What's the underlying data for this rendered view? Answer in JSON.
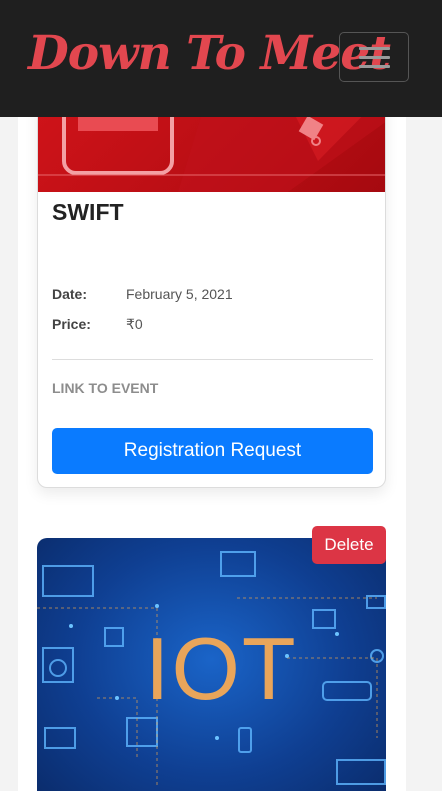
{
  "navbar": {
    "brand": "Down To Meet",
    "menu_icon": "hamburger-menu-icon"
  },
  "events": [
    {
      "image_icon": "chat-bubble-icon",
      "title": "SWIFT",
      "date_label": "Date:",
      "date_value": "February 5, 2021",
      "price_label": "Price:",
      "price_value": "₹0",
      "link_text": "LINK TO EVENT",
      "button_label": "Registration Request"
    },
    {
      "image_text": "IOT",
      "image_icon": "iot-devices-icon",
      "delete_label": "Delete"
    }
  ],
  "colors": {
    "navbar_bg": "#1f1f1f",
    "brand": "#e2474f",
    "primary": "#0a7bff",
    "danger": "#dc3545"
  }
}
